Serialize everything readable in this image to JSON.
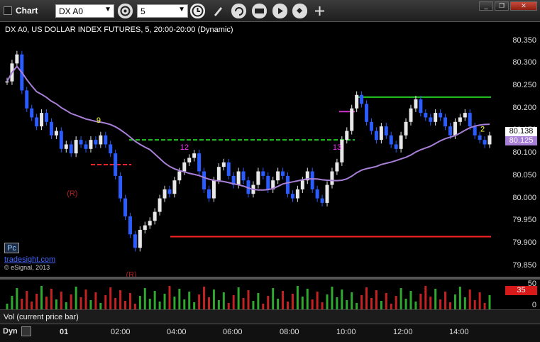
{
  "toolbar": {
    "title": "Chart",
    "symbol": "DX A0",
    "interval": "5",
    "button_icons": [
      "clock-icon",
      "pencil-icon",
      "refresh-icon",
      "gci-icon",
      "play-icon",
      "cursor-icon"
    ]
  },
  "window_buttons": [
    "minimize",
    "restore",
    "close"
  ],
  "chart_header": "DX A0, US DOLLAR INDEX FUTURES, 5, 20:00-20:00 (Dynamic)",
  "price_axis": {
    "ticks": [
      "80.350",
      "80.300",
      "80.250",
      "80.200",
      "80.150",
      "80.100",
      "80.050",
      "80.000",
      "79.950",
      "79.900",
      "79.850"
    ],
    "last_price": "80.138",
    "ma_price": "80.125",
    "colors": {
      "last_price_bg": "#ffffff",
      "ma_price_bg": "#a77fd6"
    }
  },
  "chart_data": {
    "type": "candlestick",
    "symbol": "DX A0",
    "ylim": [
      79.84,
      80.37
    ],
    "x_ticks": [
      "01",
      "02:00",
      "04:00",
      "06:00",
      "08:00",
      "10:00",
      "12:00",
      "14:00"
    ],
    "lines": [
      {
        "color": "#22cc22",
        "style": "dashed",
        "y": 80.13
      },
      {
        "color": "#ff2222",
        "style": "dashed",
        "y": 80.075
      },
      {
        "color": "#ff2222",
        "style": "solid",
        "y": 79.915
      },
      {
        "color": "#22cc22",
        "style": "solid",
        "y": 80.225
      },
      {
        "color": "#cc33cc",
        "style": "solid",
        "y": 80.193
      }
    ],
    "close_series": [
      80.26,
      80.3,
      80.32,
      80.24,
      80.2,
      80.18,
      80.16,
      80.19,
      80.17,
      80.14,
      80.15,
      80.11,
      80.12,
      80.1,
      80.13,
      80.12,
      80.11,
      80.13,
      80.12,
      80.14,
      80.12,
      80.1,
      80.05,
      80.0,
      79.96,
      79.92,
      79.89,
      79.93,
      79.94,
      79.95,
      79.97,
      80.0,
      80.02,
      80.01,
      80.04,
      80.06,
      80.08,
      80.09,
      80.1,
      80.06,
      80.02,
      80.0,
      80.04,
      80.07,
      80.08,
      80.05,
      80.03,
      80.06,
      80.04,
      80.01,
      80.03,
      80.06,
      80.05,
      80.02,
      80.04,
      80.06,
      80.05,
      80.01,
      80.0,
      80.02,
      80.04,
      80.06,
      80.02,
      80.0,
      79.99,
      80.03,
      80.06,
      80.08,
      80.13,
      80.15,
      80.2,
      80.23,
      80.21,
      80.17,
      80.15,
      80.13,
      80.16,
      80.14,
      80.12,
      80.11,
      80.14,
      80.17,
      80.2,
      80.22,
      80.19,
      80.18,
      80.17,
      80.19,
      80.18,
      80.16,
      80.14,
      80.17,
      80.18,
      80.19,
      80.16,
      80.14,
      80.13,
      80.12,
      80.14
    ],
    "volume_axis": [
      "50",
      "35",
      "0"
    ],
    "annotations": [
      {
        "text": "(R)",
        "color": "#aa2222"
      },
      {
        "text": "(R)",
        "color": "#aa2222"
      },
      {
        "text": "12",
        "color": "#ff33ff"
      },
      {
        "text": "13",
        "color": "#ff33ff"
      },
      {
        "text": "9",
        "color": "#ffff33"
      },
      {
        "text": "2",
        "color": "#ffff33"
      }
    ]
  },
  "volume": {
    "label": "Vol (current price bar)",
    "last": "35"
  },
  "bottom": {
    "dyn_label": "Dyn"
  },
  "watermarks": {
    "site": "tradesight.com",
    "copyright": "© eSignal, 2013",
    "pc": "Pc"
  }
}
